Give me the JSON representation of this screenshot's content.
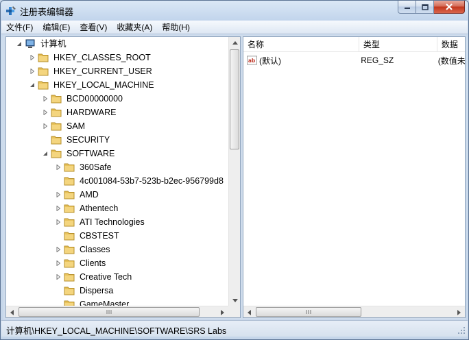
{
  "window": {
    "title": "注册表编辑器"
  },
  "menu": [
    {
      "label": "文件(F)"
    },
    {
      "label": "编辑(E)"
    },
    {
      "label": "查看(V)"
    },
    {
      "label": "收藏夹(A)"
    },
    {
      "label": "帮助(H)"
    }
  ],
  "tree": {
    "root": "计算机",
    "items": [
      {
        "label": "HKEY_CLASSES_ROOT",
        "level": 1,
        "expander": "collapsed"
      },
      {
        "label": "HKEY_CURRENT_USER",
        "level": 1,
        "expander": "collapsed"
      },
      {
        "label": "HKEY_LOCAL_MACHINE",
        "level": 1,
        "expander": "expanded"
      },
      {
        "label": "BCD00000000",
        "level": 2,
        "expander": "collapsed"
      },
      {
        "label": "HARDWARE",
        "level": 2,
        "expander": "collapsed"
      },
      {
        "label": "SAM",
        "level": 2,
        "expander": "collapsed"
      },
      {
        "label": "SECURITY",
        "level": 2,
        "expander": "none"
      },
      {
        "label": "SOFTWARE",
        "level": 2,
        "expander": "expanded"
      },
      {
        "label": "360Safe",
        "level": 3,
        "expander": "collapsed"
      },
      {
        "label": "4c001084-53b7-523b-b2ec-956799d8",
        "level": 3,
        "expander": "none"
      },
      {
        "label": "AMD",
        "level": 3,
        "expander": "collapsed"
      },
      {
        "label": "Athentech",
        "level": 3,
        "expander": "collapsed"
      },
      {
        "label": "ATI Technologies",
        "level": 3,
        "expander": "collapsed"
      },
      {
        "label": "CBSTEST",
        "level": 3,
        "expander": "none"
      },
      {
        "label": "Classes",
        "level": 3,
        "expander": "collapsed"
      },
      {
        "label": "Clients",
        "level": 3,
        "expander": "collapsed"
      },
      {
        "label": "Creative Tech",
        "level": 3,
        "expander": "collapsed"
      },
      {
        "label": "Dispersa",
        "level": 3,
        "expander": "none"
      },
      {
        "label": "GameMaster",
        "level": 3,
        "expander": "none"
      }
    ]
  },
  "list": {
    "columns": [
      {
        "label": "名称"
      },
      {
        "label": "类型"
      },
      {
        "label": "数据"
      }
    ],
    "rows": [
      {
        "name": "(默认)",
        "type": "REG_SZ",
        "data": "(数值未设置)",
        "icon": "string-value-icon"
      }
    ]
  },
  "statusbar": {
    "path": "计算机\\HKEY_LOCAL_MACHINE\\SOFTWARE\\SRS Labs"
  },
  "colors": {
    "folder": "#e8c25a",
    "window_frame": "#cbd9ea",
    "close_button": "#c2361c"
  }
}
